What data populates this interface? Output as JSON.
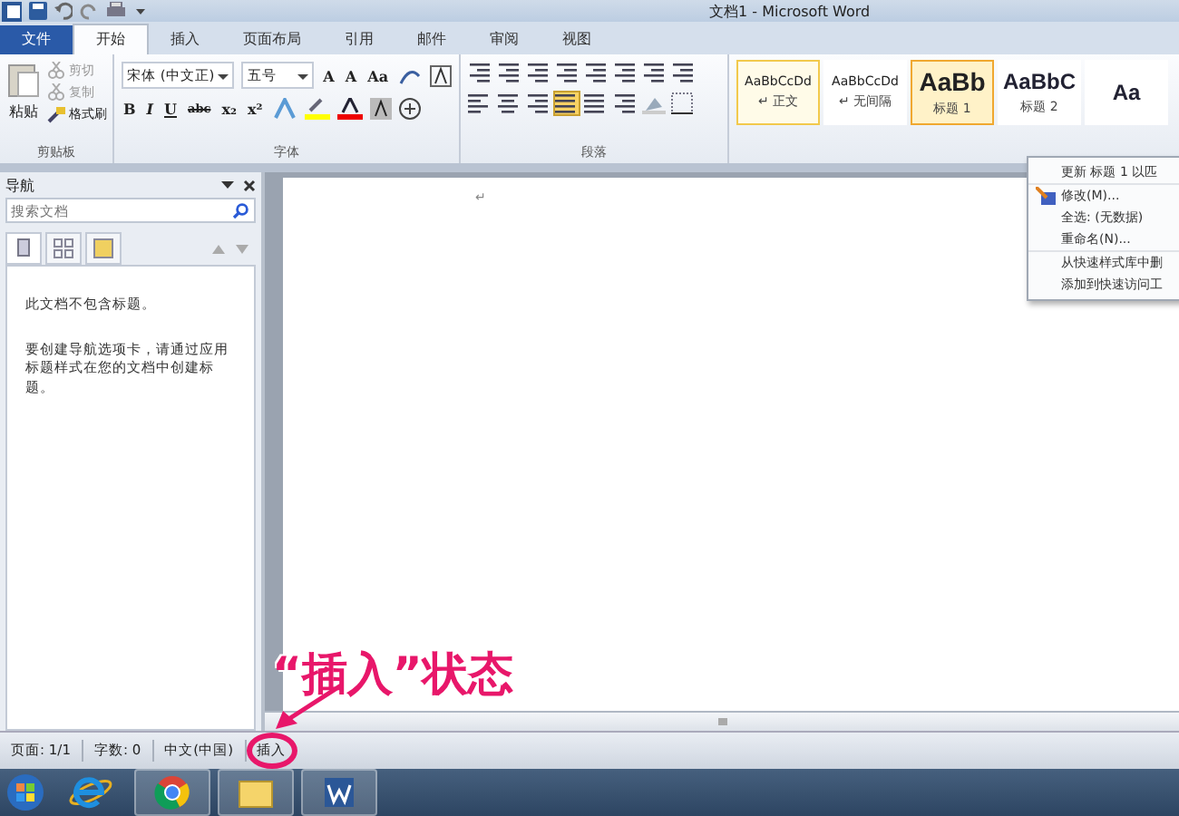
{
  "window": {
    "title": "文档1 - Microsoft Word"
  },
  "tabs": [
    {
      "label": "文件",
      "kind": "file",
      "selected": false
    },
    {
      "label": "开始",
      "kind": "tab",
      "selected": true
    },
    {
      "label": "插入",
      "kind": "tab",
      "selected": false
    },
    {
      "label": "页面布局",
      "kind": "tab",
      "selected": false
    },
    {
      "label": "引用",
      "kind": "tab",
      "selected": false
    },
    {
      "label": "邮件",
      "kind": "tab",
      "selected": false
    },
    {
      "label": "审阅",
      "kind": "tab",
      "selected": false
    },
    {
      "label": "视图",
      "kind": "tab",
      "selected": false
    }
  ],
  "clipboard": {
    "paste": "粘贴",
    "items": [
      "剪切",
      "复制",
      "格式刷"
    ],
    "label": "剪贴板"
  },
  "font": {
    "font_name": "宋体 (中文正)",
    "font_size": "五号",
    "size_buttons": [
      "A",
      "A",
      "Aa"
    ],
    "format_buttons": [
      "B",
      "I",
      "U",
      "abc",
      "x₂",
      "x²"
    ],
    "label": "字体"
  },
  "paragraph": {
    "label": "段落"
  },
  "styles": [
    {
      "preview": "AaBbCcDd",
      "name": "↵ 正文",
      "kind": "small",
      "selected": true,
      "highlighted": false
    },
    {
      "preview": "AaBbCcDd",
      "name": "↵ 无间隔",
      "kind": "small",
      "selected": false,
      "highlighted": false
    },
    {
      "preview": "AaBb",
      "name": "标题 1",
      "kind": "heading1",
      "selected": false,
      "highlighted": true
    },
    {
      "preview": "AaBbC",
      "name": "标题 2",
      "kind": "heading2",
      "selected": false,
      "highlighted": false
    },
    {
      "preview": "Aa",
      "kind": "heading2",
      "selected": false,
      "highlighted": false
    }
  ],
  "context_menu": [
    {
      "label": "更新 标题 1 以匹"
    },
    {
      "label": "修改(M)...",
      "icon": true
    },
    {
      "label": "全选: (无数据)"
    },
    {
      "label": "重命名(N)..."
    },
    {
      "label": "从快速样式库中删"
    },
    {
      "label": "添加到快速访问工"
    }
  ],
  "nav_pane": {
    "title": "导航",
    "search_placeholder": "搜索文档",
    "messages": [
      "此文档不包含标题。",
      "要创建导航选项卡，请通过应用标题样式在您的文档中创建标题。"
    ]
  },
  "document": {
    "paragraph_mark": "↵"
  },
  "status_bar": [
    {
      "label": "页面: 1/1"
    },
    {
      "label": "字数: 0"
    },
    {
      "label": "中文(中国)"
    },
    {
      "label": "插入",
      "highlighted": true
    }
  ],
  "annotation": {
    "text": "“插入”状态"
  }
}
